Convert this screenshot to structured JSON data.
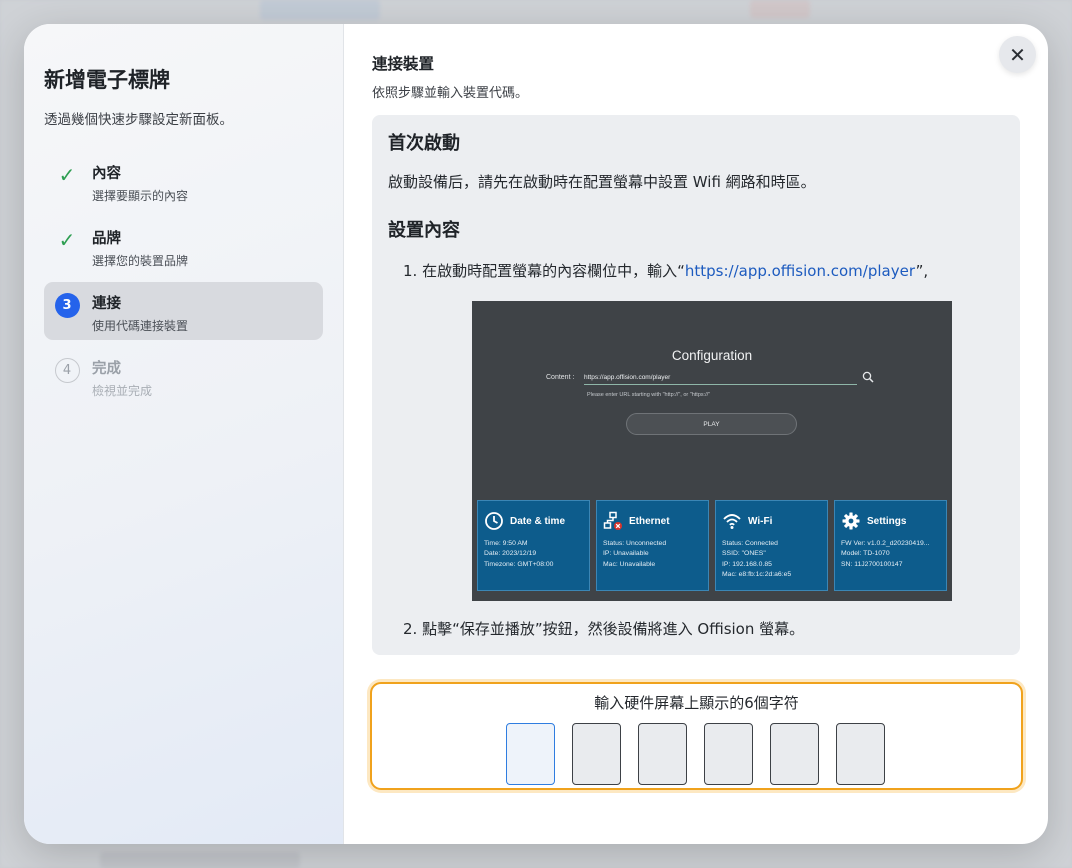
{
  "sidebar": {
    "title": "新增電子標牌",
    "subtitle": "透過幾個快速步驟設定新面板。",
    "steps": [
      {
        "label": "內容",
        "desc": "選擇要顯示的內容",
        "state": "done",
        "icon": "check-icon"
      },
      {
        "label": "品牌",
        "desc": "選擇您的裝置品牌",
        "state": "done",
        "icon": "check-icon"
      },
      {
        "number": "3",
        "label": "連接",
        "desc": "使用代碼連接裝置",
        "state": "active"
      },
      {
        "number": "4",
        "label": "完成",
        "desc": "檢視並完成",
        "state": "pending"
      }
    ]
  },
  "main": {
    "title": "連接裝置",
    "subtitle": "依照步驟並輸入裝置代碼。",
    "close_icon": "close-icon"
  },
  "guide": {
    "heading1": "首次啟動",
    "para1": "啟動設備后，請先在啟動時在配置螢幕中設置 Wifi 網路和時區。",
    "heading2": "設置內容",
    "step1_prefix": "1. 在啟動時配置螢幕的內容欄位中，輸入“",
    "step1_link": "https://app.offision.com/player",
    "step1_suffix": "”,",
    "step2": "2. 點擊“保存並播放”按鈕，然後設備將進入 Offision 螢幕。"
  },
  "device_screen": {
    "title": "Configuration",
    "content_label": "Content :",
    "content_value": "https://app.offision.com/player",
    "hint": "Please enter URL starting with \"http://\", or \"https://\"",
    "play_label": "PLAY",
    "tiles": [
      {
        "title": "Date & time",
        "icon": "clock-icon",
        "lines": [
          "Time: 9:50 AM",
          "Date: 2023/12/19",
          "Timezone: GMT+08:00"
        ]
      },
      {
        "title": "Ethernet",
        "icon": "ethernet-icon",
        "lines": [
          "Status: Unconnected",
          "IP: Unavailable",
          "Mac: Unavailable"
        ]
      },
      {
        "title": "Wi-Fi",
        "icon": "wifi-icon",
        "lines": [
          "Status: Connected",
          "SSID: \"ONES\"",
          "IP: 192.168.0.85",
          "Mac: e8:fb:1c:2d:a6:e5"
        ]
      },
      {
        "title": "Settings",
        "icon": "gear-icon",
        "lines": [
          "FW Ver: v1.0.2_d20230419...",
          "Model: TD-1070",
          "SN: 11J2700100147"
        ]
      }
    ]
  },
  "code_entry": {
    "label": "輸入硬件屏幕上顯示的6個字符",
    "cells": [
      "",
      "",
      "",
      "",
      "",
      ""
    ],
    "accent_color": "#f0a21c"
  },
  "colors": {
    "primary": "#2563eb",
    "success": "#2e9e52",
    "link": "#1d5bbf",
    "tile": "#0d5c8c"
  }
}
